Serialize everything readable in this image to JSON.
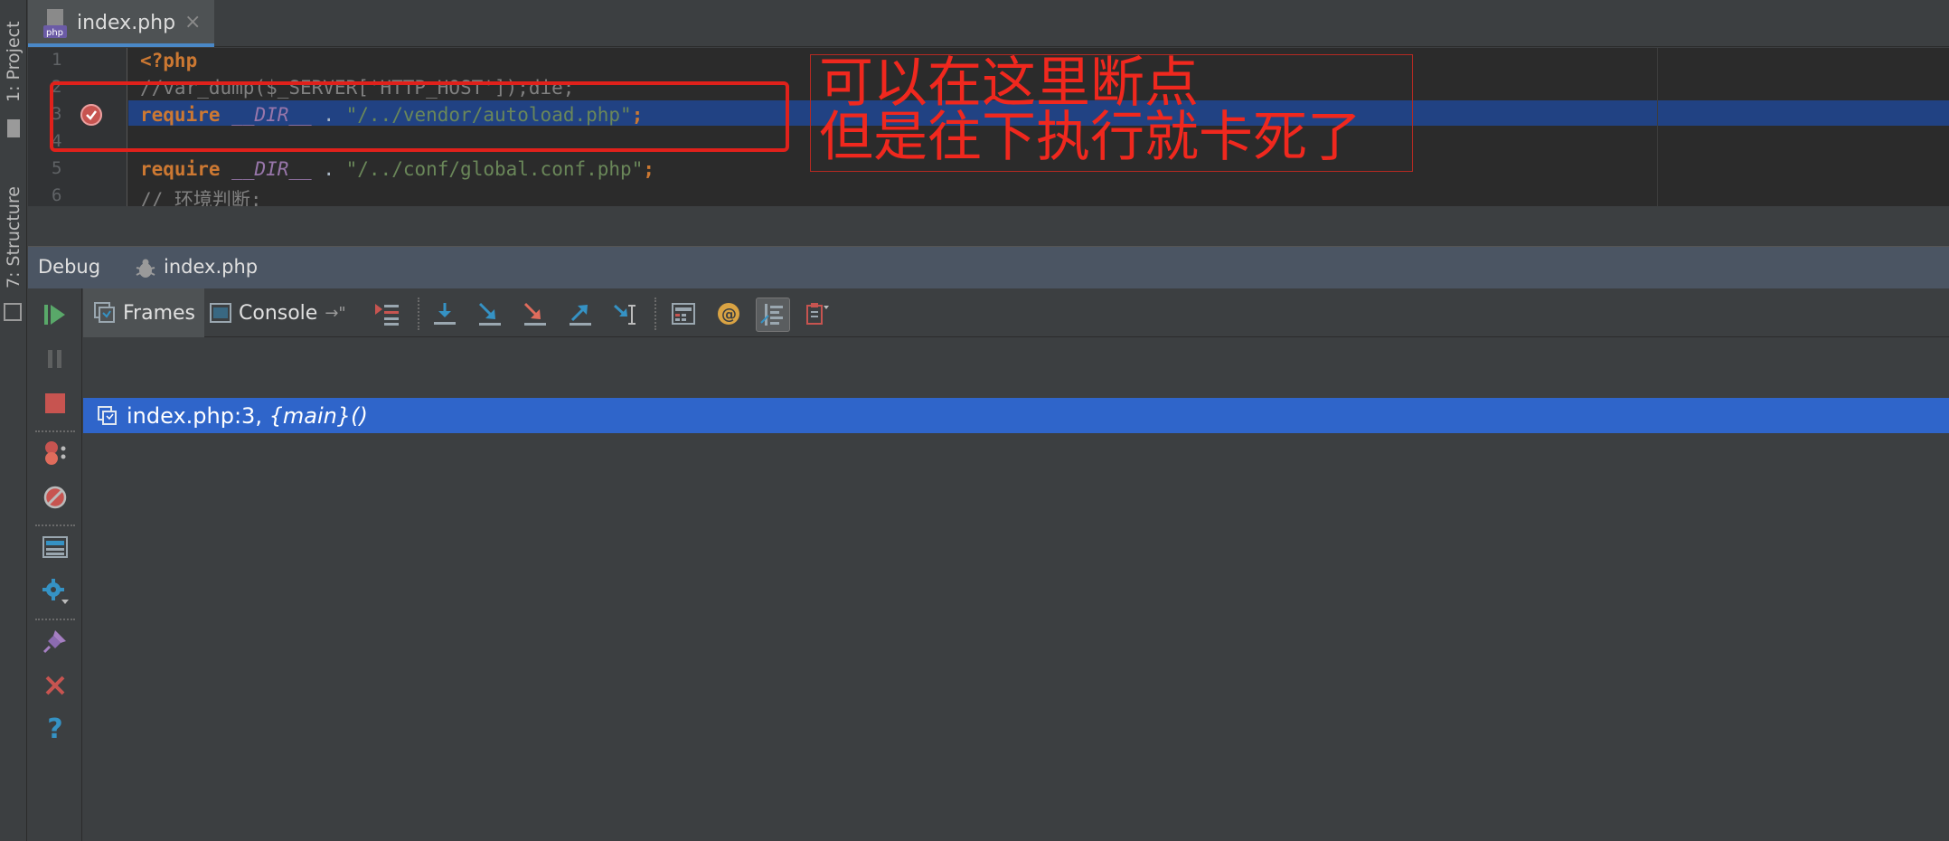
{
  "left_strip": {
    "project_tab": "1: Project",
    "structure_tab": "7: Structure"
  },
  "editor_tab": {
    "label": "index.php",
    "icon": "php-file-icon",
    "close_glyph": "×"
  },
  "editor": {
    "lines": [
      {
        "num": "1"
      },
      {
        "num": "2"
      },
      {
        "num": "3"
      },
      {
        "num": "4"
      },
      {
        "num": "5"
      },
      {
        "num": "6"
      }
    ],
    "line1": "<?php",
    "line2": "//var_dump($_SERVER['HTTP_HOST']);die;",
    "line3": {
      "kw": "require",
      "const": "__DIR__",
      "op": " . ",
      "str": "\"/../vendor/autoload.php\"",
      "end": ";"
    },
    "line5": {
      "kw": "require",
      "const": "__DIR__",
      "op": " . ",
      "str": "\"/../conf/global.conf.php\"",
      "end": ";"
    },
    "line6": "// 环境判断:",
    "breakpoint_line": 3
  },
  "annotation": {
    "line1": "可以在这里断点",
    "line2": "但是往下执行就卡死了",
    "color": "#f0281e"
  },
  "debug": {
    "title": "Debug",
    "file": "index.php",
    "tabs": {
      "frames": "Frames",
      "console": "Console"
    },
    "left_toolbar_icons": [
      "resume-icon",
      "pause-icon",
      "stop-icon",
      "view-breakpoints-icon",
      "mute-breakpoints-icon",
      "layout-icon",
      "settings-icon",
      "pin-icon",
      "close-icon",
      "help-icon"
    ],
    "toolbar_icons": [
      "show-execution-point-icon",
      "step-over-icon",
      "step-into-icon",
      "force-step-into-icon",
      "step-out-icon",
      "run-to-cursor-icon",
      "evaluate-expression-icon",
      "watch-icon",
      "show-values-icon",
      "restore-layout-icon"
    ],
    "frame": {
      "location": "index.php:3, ",
      "function": "{main}()"
    }
  },
  "colors": {
    "selection": "#214283",
    "frame_selected": "#2f65ca",
    "keyword": "#cc7832",
    "constant": "#9876aa",
    "string": "#6a8759",
    "comment": "#808080"
  }
}
